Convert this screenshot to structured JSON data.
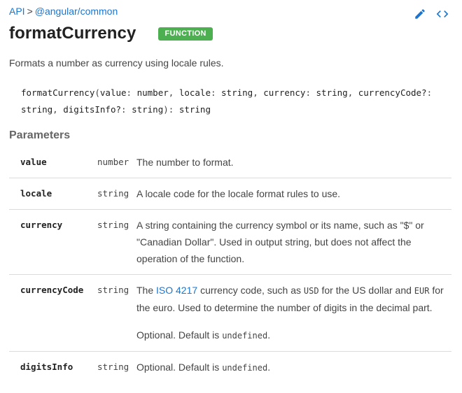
{
  "breadcrumb": {
    "root": "API",
    "separator": ">",
    "package": "@angular/common"
  },
  "header": {
    "title": "formatCurrency",
    "badge": "FUNCTION",
    "icons": [
      "edit-icon",
      "code-icon"
    ]
  },
  "description": "Formats a number as currency using locale rules.",
  "signature": {
    "name": "formatCurrency",
    "open": "(",
    "params": [
      {
        "name": "value",
        "type": "number"
      },
      {
        "name": "locale",
        "type": "string"
      },
      {
        "name": "currency",
        "type": "string"
      },
      {
        "name": "currencyCode?",
        "type": "string"
      },
      {
        "name": "digitsInfo?",
        "type": "string"
      }
    ],
    "close": ")",
    "return_sep": ":",
    "return_type": "string"
  },
  "parameters_heading": "Parameters",
  "parameters": [
    {
      "name": "value",
      "type": "number",
      "desc": "The number to format."
    },
    {
      "name": "locale",
      "type": "string",
      "desc": "A locale code for the locale format rules to use."
    },
    {
      "name": "currency",
      "type": "string",
      "desc": "A string containing the currency symbol or its name, such as \"$\" or \"Canadian Dollar\". Used in output string, but does not affect the operation of the function."
    },
    {
      "name": "currencyCode",
      "type": "string",
      "desc_prefix": "The",
      "link": "ISO 4217",
      "desc_mid1": "currency code, such as",
      "code1": "USD",
      "desc_mid2": "for the US dollar and",
      "code2": "EUR",
      "desc_suffix": "for the euro. Used to determine the number of digits in the decimal part.",
      "optional_prefix": "Optional. Default is",
      "optional_code": "undefined",
      "optional_suffix": "."
    },
    {
      "name": "digitsInfo",
      "type": "string",
      "optional_prefix": "Optional. Default is",
      "optional_code": "undefined",
      "optional_suffix": "."
    }
  ],
  "colors": {
    "link": "#1976d2",
    "badge": "#4caf50",
    "title": "#212121",
    "text": "#444444"
  }
}
